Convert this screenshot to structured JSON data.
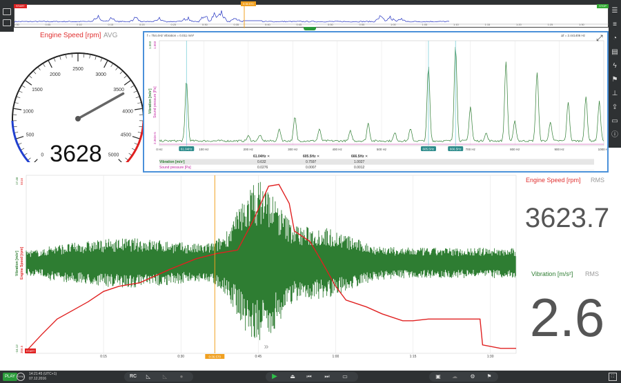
{
  "overview": {
    "start_label": "START",
    "stop_label": "STOP",
    "marker_label": "0:36.570",
    "ticks": [
      "0:00",
      "0:05",
      "0:10",
      "0:15",
      "0:20",
      "0:25",
      "0:30",
      "0:35",
      "0:40",
      "0:45",
      "0:50",
      "0:55",
      "1:00",
      "1:05",
      "1:10",
      "1:15",
      "1:20",
      "1:25",
      "1:30",
      "1:35"
    ]
  },
  "gauge": {
    "title": "Engine Speed [rpm]",
    "mode": "AVG",
    "value": "3628",
    "value_num": 3628,
    "min": 0,
    "max": 5000,
    "ticks": [
      "0",
      "500",
      "1000",
      "1500",
      "2000",
      "2500",
      "3000",
      "3500",
      "4000",
      "4500",
      "5000"
    ]
  },
  "spectrum": {
    "cursor_text": "f = 754.4Hz Vibration = 0.011 m/s²",
    "df_text": "Δf = 2.441406 Hz",
    "y_label_vibration": "Vibration [m/s²]",
    "y_label_pressure": "Sound pressure [Pa]",
    "y_top_vib": "1.503",
    "y_top_press": "1.503",
    "y_bottom": "2.362e-5",
    "x_ticks": [
      "0 Hz",
      "100 Hz",
      "200 Hz",
      "300 Hz",
      "400 Hz",
      "500 Hz",
      "600 Hz",
      "700 Hz",
      "800 Hz",
      "900 Hz",
      "1000 Hz"
    ],
    "cursor_labels": [
      "61.04Hz",
      "605.5Hz",
      "666.5Hz"
    ],
    "table": {
      "headers": [
        "61.04Hz ✕",
        "605.5Hz ✕",
        "666.5Hz ✕"
      ],
      "rows": [
        {
          "label": "Vibration [m/s²]",
          "values": [
            "0.632",
            "0.7597",
            "1.0027"
          ]
        },
        {
          "label": "Sound pressure [Pa]",
          "values": [
            "0.0276",
            "0.0007",
            "0.0012"
          ]
        }
      ]
    }
  },
  "timeplot": {
    "y_label_vibration": "Vibration [m/s²]",
    "y_label_speed": "Engine Speed [rpm]",
    "y_top_vib": "17.46",
    "y_top_speed": "5516",
    "y_bottom_vib": "-16.12",
    "y_bottom_speed": "356.5",
    "start_label": "START",
    "marker_label": "0:36.570",
    "x_ticks": [
      "0:15",
      "0:30",
      "0:45",
      "1:00",
      "1:15",
      "1:30"
    ]
  },
  "readouts": {
    "engine": {
      "title": "Engine Speed [rpm]",
      "mode": "RMS",
      "value": "3623.7"
    },
    "vibration": {
      "title": "Vibration [m/s²]",
      "mode": "RMS",
      "value": "2.6"
    }
  },
  "bottombar": {
    "play_label": "PLAY",
    "sync_label": "SYNC",
    "time": "14:21:45 (UTC+1)",
    "date": "07.12.2016",
    "rc_label": "RC"
  },
  "colors": {
    "vibration": "#2e7d32",
    "speed": "#e02020",
    "pressure": "#c020a0",
    "cursor": "#7fd0d8",
    "marker": "#f0a020"
  }
}
